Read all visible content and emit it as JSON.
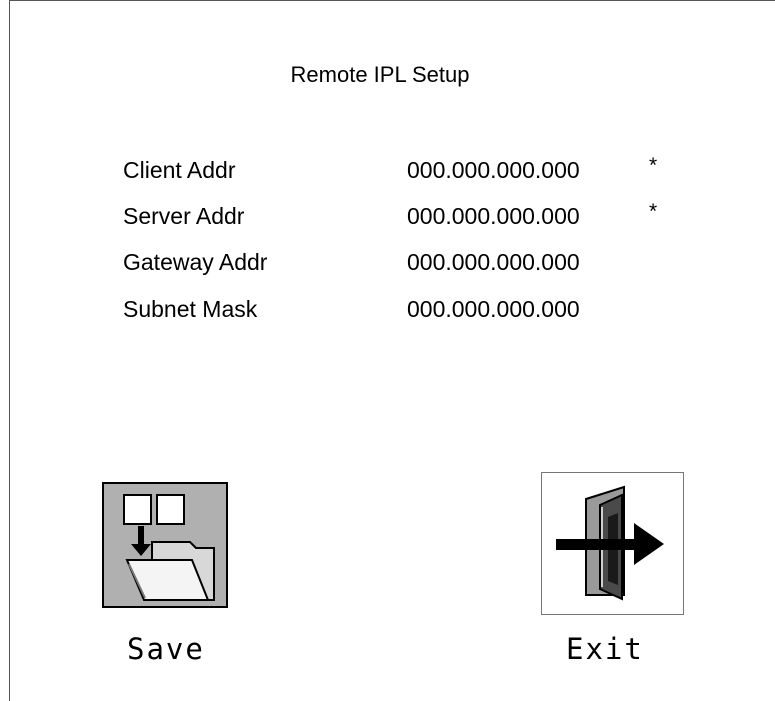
{
  "screen": {
    "title": "Remote IPL Setup"
  },
  "fields": [
    {
      "label": "Client  Addr",
      "value": "000.000.000.000",
      "marker": "*"
    },
    {
      "label": "Server  Addr",
      "value": "000.000.000.000",
      "marker": "*"
    },
    {
      "label": "Gateway  Addr",
      "value": "000.000.000.000",
      "marker": ""
    },
    {
      "label": "Subnet  Mask",
      "value": "000.000.000.000",
      "marker": ""
    }
  ],
  "actions": {
    "save": {
      "label": "Save",
      "icon": "folder-save-icon"
    },
    "exit": {
      "label": "Exit",
      "icon": "door-exit-icon"
    }
  }
}
